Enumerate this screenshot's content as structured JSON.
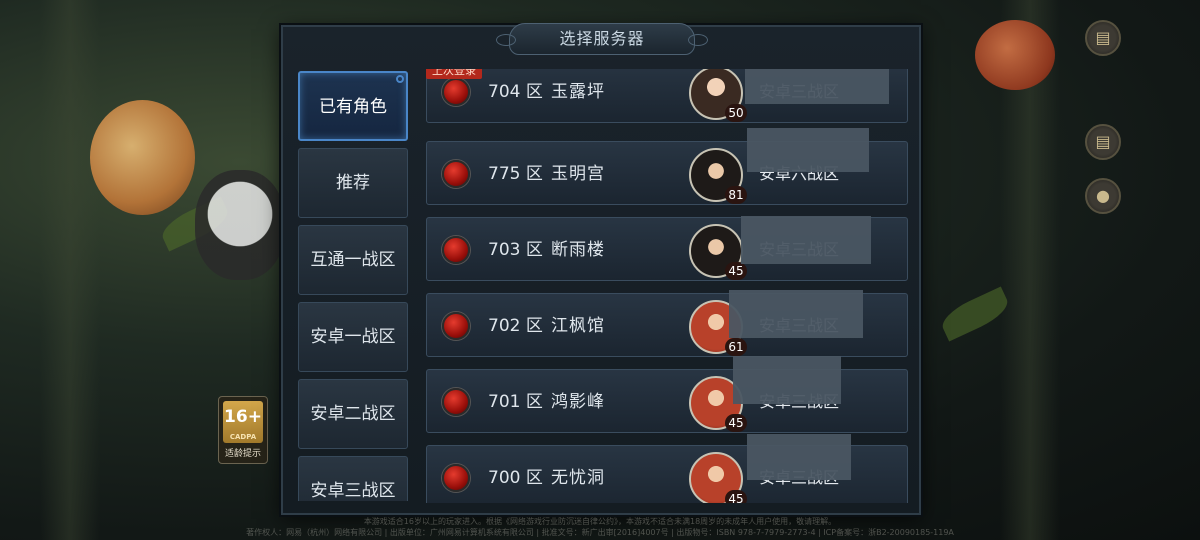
{
  "panel": {
    "title": "选择服务器"
  },
  "tabs": [
    {
      "label": "已有角色",
      "active": true
    },
    {
      "label": "推荐",
      "active": false
    },
    {
      "label": "互通一战区",
      "active": false
    },
    {
      "label": "安卓一战区",
      "active": false
    },
    {
      "label": "安卓二战区",
      "active": false
    },
    {
      "label": "安卓三战区",
      "active": false
    }
  ],
  "last_login_badge": "上次登录",
  "servers": [
    {
      "number": "704 区",
      "name": "玉露坪",
      "level": "50",
      "zone": "安卓三战区",
      "status_color": "#c8140c",
      "avatar": "female-warrior-icon"
    },
    {
      "number": "775 区",
      "name": "玉明宫",
      "level": "81",
      "zone": "安卓六战区",
      "status_color": "#c8140c",
      "avatar": "female-mage-icon"
    },
    {
      "number": "703 区",
      "name": "断雨楼",
      "level": "45",
      "zone": "安卓三战区",
      "status_color": "#c8140c",
      "avatar": "male-swordsman-icon"
    },
    {
      "number": "702 区",
      "name": "江枫馆",
      "level": "61",
      "zone": "安卓三战区",
      "status_color": "#c8140c",
      "avatar": "female-redhair-icon"
    },
    {
      "number": "701 区",
      "name": "鸿影峰",
      "level": "45",
      "zone": "安卓三战区",
      "status_color": "#c8140c",
      "avatar": "female-redhair-icon"
    },
    {
      "number": "700 区",
      "name": "无忧洞",
      "level": "45",
      "zone": "安卓三战区",
      "status_color": "#c8140c",
      "avatar": "female-redhair-icon"
    }
  ],
  "age_rating": {
    "value": "16+",
    "sub": "CADPA",
    "tip": "适龄提示"
  },
  "footer": {
    "line1": "本游戏适合16岁以上的玩家进入。根据《网络游戏行业防沉迷自律公约》，本游戏不适合未满18周岁的未成年人用户使用，敬请理解。",
    "line2": "著作权人：网易（杭州）网络有限公司 | 出版单位：广州网易计算机系统有限公司 | 批准文号：新广出审[2016]4007号 | 出版物号：ISBN 978-7-7979-2773-4 | ICP备案号：浙B2-20090185-119A"
  },
  "colors": {
    "accent": "#4a86c8",
    "status_red": "#c8140c",
    "panel_bg": "#1a232b"
  }
}
